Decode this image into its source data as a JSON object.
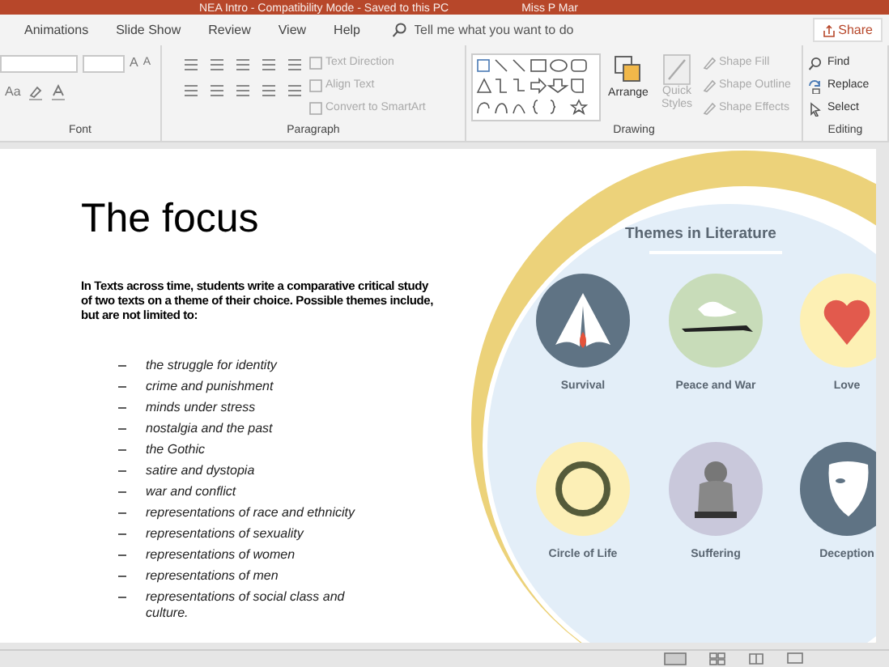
{
  "window": {
    "title": "NEA Intro - Compatibility Mode - Saved to this PC",
    "user": "Miss P Mar"
  },
  "tabs": [
    {
      "label": "Animations",
      "selected": false
    },
    {
      "label": "Slide Show",
      "selected": false
    },
    {
      "label": "Review",
      "selected": false
    },
    {
      "label": "View",
      "selected": false
    },
    {
      "label": "Help",
      "selected": false
    }
  ],
  "search": {
    "placeholder": "Tell me what you want to do"
  },
  "share_button": "Share",
  "ribbon": {
    "groups": [
      {
        "label": "Font",
        "kind": "font",
        "glyphs": [
          "A",
          "A",
          "Aa"
        ]
      },
      {
        "label": "Paragraph",
        "kind": "paragraph",
        "buttons": [
          {
            "label": "Text Direction",
            "disabled": true
          },
          {
            "label": "Align Text",
            "disabled": true
          },
          {
            "label": "Convert to SmartArt",
            "disabled": true
          }
        ]
      },
      {
        "label": "Drawing",
        "kind": "drawing",
        "arrange": "Arrange",
        "quick_styles": {
          "label": "Quick Styles",
          "disabled": true
        },
        "buttons": [
          {
            "label": "Shape Fill",
            "disabled": true
          },
          {
            "label": "Shape Outline",
            "disabled": true
          },
          {
            "label": "Shape Effects",
            "disabled": true
          }
        ]
      },
      {
        "label": "Editing",
        "kind": "editing",
        "buttons": [
          {
            "label": "Find",
            "disabled": false
          },
          {
            "label": "Replace",
            "disabled": false
          },
          {
            "label": "Select",
            "disabled": false
          }
        ]
      }
    ]
  },
  "slide": {
    "title": "The focus",
    "intro": "In Texts across time, students write a comparative critical study of two texts on a theme of their choice. Possible themes include, but are not limited to:",
    "themes": [
      "the struggle for identity",
      "crime and punishment",
      "minds under stress",
      "nostalgia and the past",
      "the Gothic",
      "satire and dystopia",
      "war and conflict",
      "representations of race and ethnicity",
      "representations of sexuality",
      "representations of women",
      "representations of men",
      "representations of social class and culture."
    ],
    "infographic": {
      "title": "Themes in Literature",
      "items": [
        {
          "label": "Survival",
          "kind": "tent",
          "color": "#5f7384"
        },
        {
          "label": "Peace and War",
          "kind": "dove",
          "color": "#c8dcb9"
        },
        {
          "label": "Love",
          "kind": "heart",
          "color": "#fdf0b4"
        },
        {
          "label": "Circle of Life",
          "kind": "ring",
          "color": "#fcefb6"
        },
        {
          "label": "Suffering",
          "kind": "figure",
          "color": "#c9c8db"
        },
        {
          "label": "Deception",
          "kind": "mask",
          "color": "#5f7384"
        }
      ]
    }
  }
}
